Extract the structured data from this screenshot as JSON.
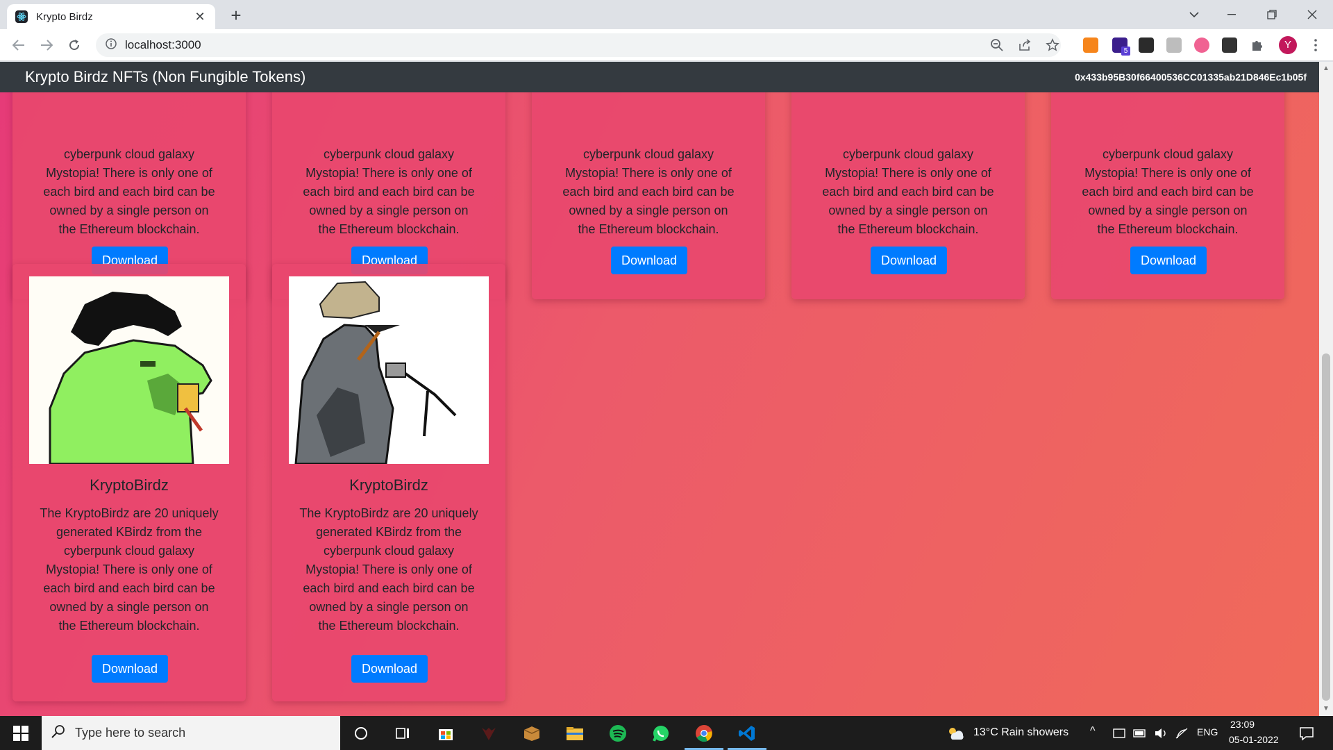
{
  "browser": {
    "tab_title": "Krypto Birdz",
    "new_tab_symbol": "+",
    "close_symbol": "✕",
    "url": "localhost:3000",
    "extension_badge": "5",
    "profile_initial": "Y"
  },
  "navbar": {
    "brand": "Krypto Birdz NFTs (Non Fungible Tokens)",
    "account": "0x433b95B30f66400536CC01335ab21D846Ec1b05f"
  },
  "top_cards": [
    {
      "text_lines": [
        "cyberpunk cloud galaxy",
        "Mystopia! There is only one of",
        "each bird and each bird can be",
        "owned by a single person on",
        "the Ethereum blockchain."
      ],
      "button": "Download"
    },
    {
      "text_lines": [
        "cyberpunk cloud galaxy",
        "Mystopia! There is only one of",
        "each bird and each bird can be",
        "owned by a single person on",
        "the Ethereum blockchain."
      ],
      "button": "Download"
    },
    {
      "text_lines": [
        "cyberpunk cloud galaxy",
        "Mystopia! There is only one of",
        "each bird and each bird can be",
        "owned by a single person on",
        "the Ethereum blockchain."
      ],
      "button": "Download"
    },
    {
      "text_lines": [
        "cyberpunk cloud galaxy",
        "Mystopia! There is only one of",
        "each bird and each bird can be",
        "owned by a single person on",
        "the Ethereum blockchain."
      ],
      "button": "Download"
    },
    {
      "text_lines": [
        "cyberpunk cloud galaxy",
        "Mystopia! There is only one of",
        "each bird and each bird can be",
        "owned by a single person on",
        "the Ethereum blockchain."
      ],
      "button": "Download"
    }
  ],
  "bottom_cards": [
    {
      "title": "KryptoBirdz",
      "text_lines": [
        "The KryptoBirdz are 20 uniquely",
        "generated KBirdz from the",
        "cyberpunk cloud galaxy",
        "Mystopia! There is only one of",
        "each bird and each bird can be",
        "owned by a single person on",
        "the Ethereum blockchain."
      ],
      "button": "Download"
    },
    {
      "title": "KryptoBirdz",
      "text_lines": [
        "The KryptoBirdz are 20 uniquely",
        "generated KBirdz from the",
        "cyberpunk cloud galaxy",
        "Mystopia! There is only one of",
        "each bird and each bird can be",
        "owned by a single person on",
        "the Ethereum blockchain."
      ],
      "button": "Download"
    }
  ],
  "taskbar": {
    "search_placeholder": "Type here to search",
    "weather": "13°C  Rain showers",
    "language": "ENG",
    "time": "23:09",
    "date": "05-01-2022"
  },
  "colors": {
    "navbar": "#343a40",
    "button": "#007bff",
    "gradient_start": "#e63a78",
    "gradient_end": "#f06a5a"
  }
}
